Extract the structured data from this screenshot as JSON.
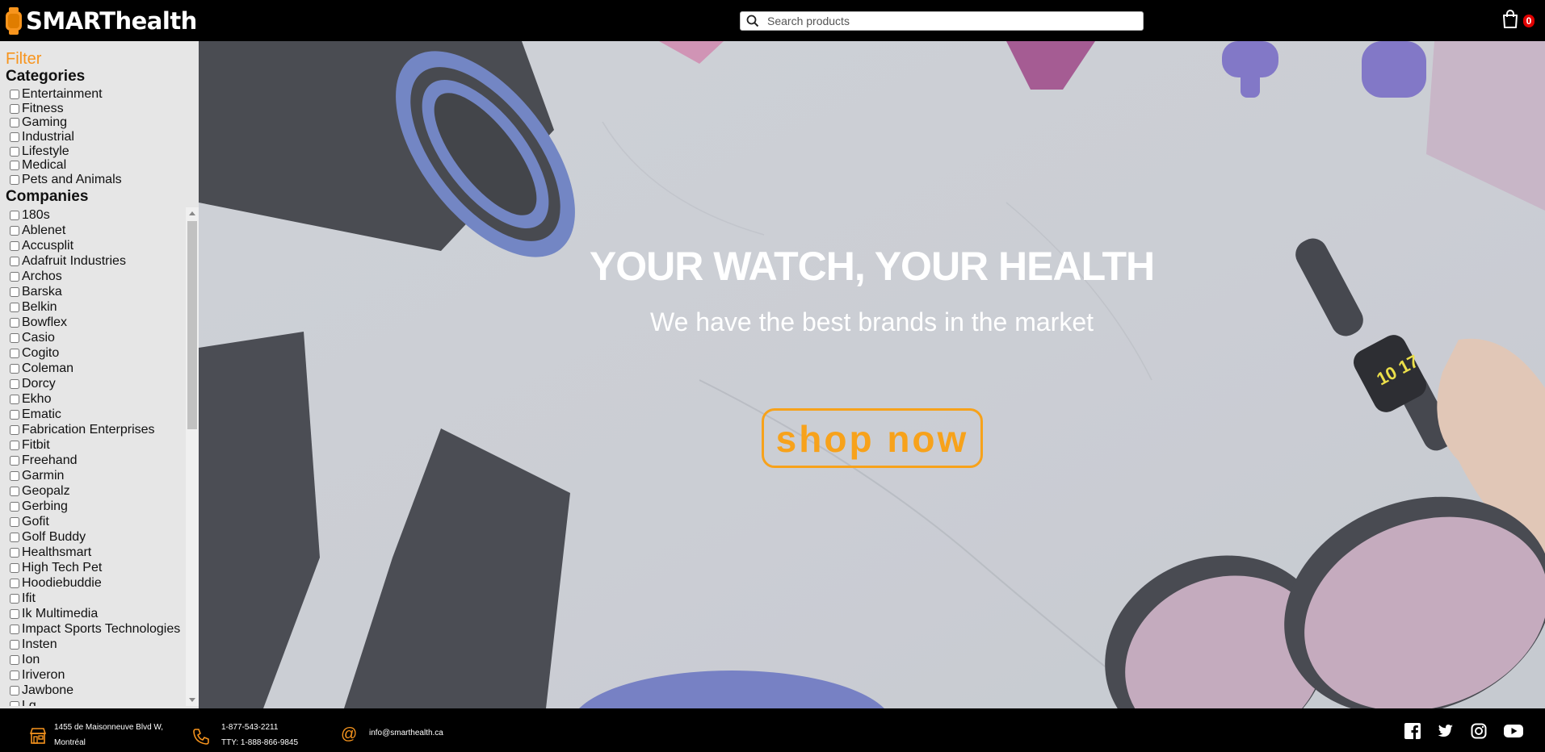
{
  "header": {
    "brand": "SMARThealth",
    "search_placeholder": "Search products",
    "cart_count": "0"
  },
  "sidebar": {
    "filter_title": "Filter",
    "categories_title": "Categories",
    "categories": [
      "Entertainment",
      "Fitness",
      "Gaming",
      "Industrial",
      "Lifestyle",
      "Medical",
      "Pets and Animals"
    ],
    "companies_title": "Companies",
    "companies": [
      "180s",
      "Ablenet",
      "Accusplit",
      "Adafruit Industries",
      "Archos",
      "Barska",
      "Belkin",
      "Bowflex",
      "Casio",
      "Cogito",
      "Coleman",
      "Dorcy",
      "Ekho",
      "Ematic",
      "Fabrication Enterprises",
      "Fitbit",
      "Freehand",
      "Garmin",
      "Geopalz",
      "Gerbing",
      "Gofit",
      "Golf Buddy",
      "Healthsmart",
      "High Tech Pet",
      "Hoodiebuddie",
      "Ifit",
      "Ik Multimedia",
      "Impact Sports Technologies",
      "Insten",
      "Ion",
      "Iriveron",
      "Jawbone",
      "Lg"
    ]
  },
  "hero": {
    "title": "YOUR WATCH, YOUR HEALTH",
    "subtitle": "We have the best brands in the market",
    "cta": "shop now",
    "watch_display": "10 17"
  },
  "footer": {
    "address_line1": "1455 de Maisonneuve Blvd W,",
    "address_line2": "Montréal",
    "phone_line1": "1-877-543-2211",
    "phone_line2": "TTY: 1-888-866-9845",
    "email": "info@smarthealth.ca",
    "social": [
      "facebook-icon",
      "twitter-icon",
      "instagram-icon",
      "youtube-icon"
    ]
  },
  "colors": {
    "accent": "#f7941d",
    "badge": "#e10000",
    "sidebar_bg": "#e6e6e6"
  }
}
